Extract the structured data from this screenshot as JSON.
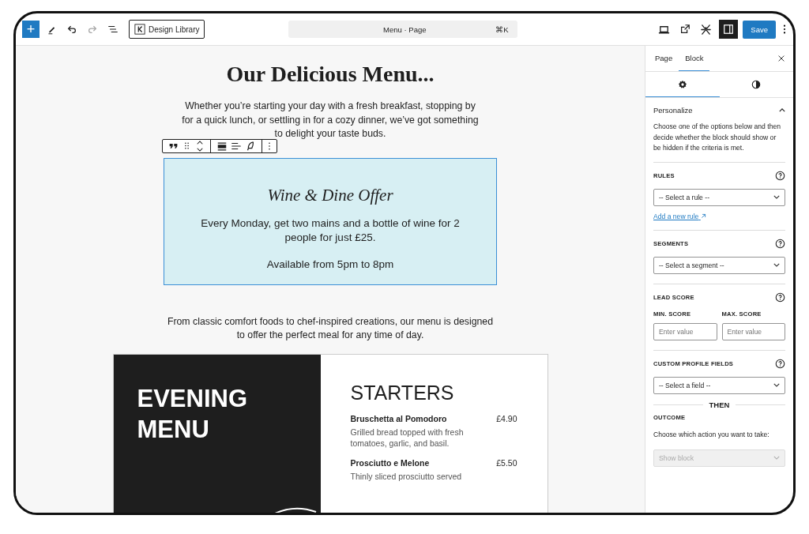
{
  "toolbar": {
    "inserter": "+",
    "library_button": "Design Library",
    "command": {
      "title": "Menu · Page",
      "shortcut": "⌘K"
    },
    "settings_toggle": {
      "on": true
    },
    "save": "Save"
  },
  "canvas": {
    "title": "Our Delicious Menu...",
    "intro": "Whether you’re starting your day with a fresh breakfast, stopping by for a quick lunch, or settling in for a cozy dinner, we’ve got something to delight your taste buds.",
    "offer": {
      "selected": true,
      "title": "Wine & Dine Offer",
      "lines": [
        "Every Monday, get two mains and a bottle of wine for 2 people for just £25.",
        "Available from 5pm to 8pm"
      ]
    },
    "outro": "From classic comfort foods to chef-inspired creations, our menu is designed to offer the perfect meal for any time of day.",
    "menu_card": {
      "heading": "EVENING MENU",
      "section": "STARTERS",
      "items": [
        {
          "name": "Bruschetta al Pomodoro",
          "price": "£4.90",
          "description": "Grilled bread topped with fresh tomatoes, garlic, and basil."
        },
        {
          "name": "Prosciutto e Melone",
          "price": "£5.50",
          "description": "Thinly sliced prosciutto served"
        }
      ]
    }
  },
  "sidebar": {
    "tabs": [
      {
        "label": "Page",
        "selected": false
      },
      {
        "label": "Block",
        "selected": true
      }
    ],
    "subtabs": [
      {
        "kind": "settings",
        "selected": true
      },
      {
        "kind": "styles",
        "selected": false
      }
    ],
    "panel": {
      "title": "Personalize",
      "expanded": true,
      "description": "Choose one of the options below and then decide whether the block should show or be hidden if the criteria is met.",
      "sections": [
        {
          "kind": "select",
          "label": "RULES",
          "select": "-- Select a rule --",
          "link": "Add a new rule"
        },
        {
          "kind": "select",
          "label": "SEGMENTS",
          "select": "-- Select a segment --"
        },
        {
          "kind": "range",
          "label": "LEAD SCORE",
          "fields": [
            {
              "label": "MIN. SCORE",
              "placeholder": "Enter value"
            },
            {
              "label": "MAX. SCORE",
              "placeholder": "Enter value"
            }
          ]
        },
        {
          "kind": "select",
          "label": "CUSTOM PROFILE FIELDS",
          "select": "-- Select a field --"
        }
      ],
      "divider": "THEN",
      "outcome": {
        "label": "OUTCOME",
        "hint": "Choose which action you want to take:",
        "select": "Show block",
        "disabled": true
      }
    }
  }
}
